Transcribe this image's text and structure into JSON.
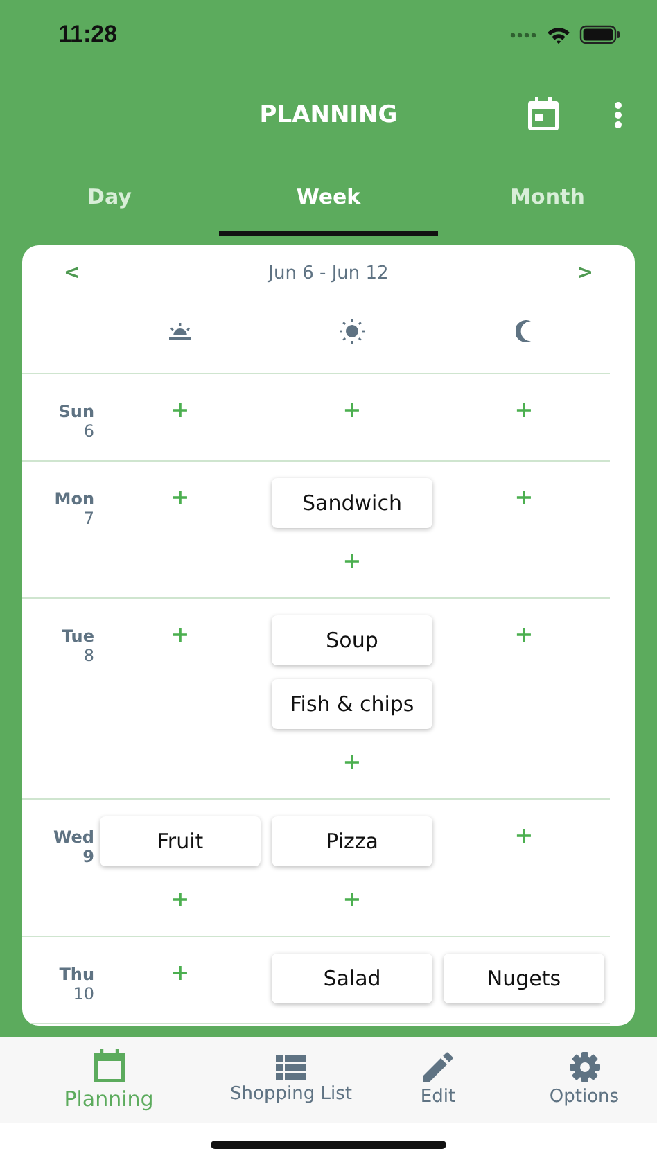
{
  "status_bar": {
    "time": "11:28"
  },
  "header": {
    "title": "PLANNING"
  },
  "tabs": [
    {
      "label": "Day",
      "selected": false
    },
    {
      "label": "Week",
      "selected": true
    },
    {
      "label": "Month",
      "selected": false
    }
  ],
  "week_nav": {
    "prev": "<",
    "range": "Jun 6 - Jun 12",
    "next": ">"
  },
  "days": [
    {
      "weekday": "Sun",
      "date": "6",
      "today": false,
      "slots": [
        {
          "add": "+"
        },
        {
          "add": "+"
        },
        {
          "add": "+"
        }
      ]
    },
    {
      "weekday": "Mon",
      "date": "7",
      "today": false,
      "slots": [
        {
          "add": "+"
        },
        {
          "meals": [
            "Sandwich"
          ],
          "add": "+"
        },
        {
          "add": "+"
        }
      ]
    },
    {
      "weekday": "Tue",
      "date": "8",
      "today": false,
      "slots": [
        {
          "add": "+"
        },
        {
          "meals": [
            "Soup",
            "Fish & chips"
          ],
          "add": "+"
        },
        {
          "add": "+"
        }
      ]
    },
    {
      "weekday": "Wed",
      "date": "9",
      "today": true,
      "slots": [
        {
          "meals": [
            "Fruit"
          ],
          "add": "+"
        },
        {
          "meals": [
            "Pizza"
          ],
          "add": "+"
        },
        {
          "add": "+"
        }
      ]
    },
    {
      "weekday": "Thu",
      "date": "10",
      "today": false,
      "slots": [
        {
          "add": "+"
        },
        {
          "meals": [
            "Salad"
          ]
        },
        {
          "meals": [
            "Nugets"
          ]
        }
      ]
    }
  ],
  "bottom_nav": [
    {
      "label": "Planning",
      "selected": true
    },
    {
      "label": "Shopping List",
      "selected": false
    },
    {
      "label": "Edit",
      "selected": false
    },
    {
      "label": "Options",
      "selected": false
    }
  ]
}
